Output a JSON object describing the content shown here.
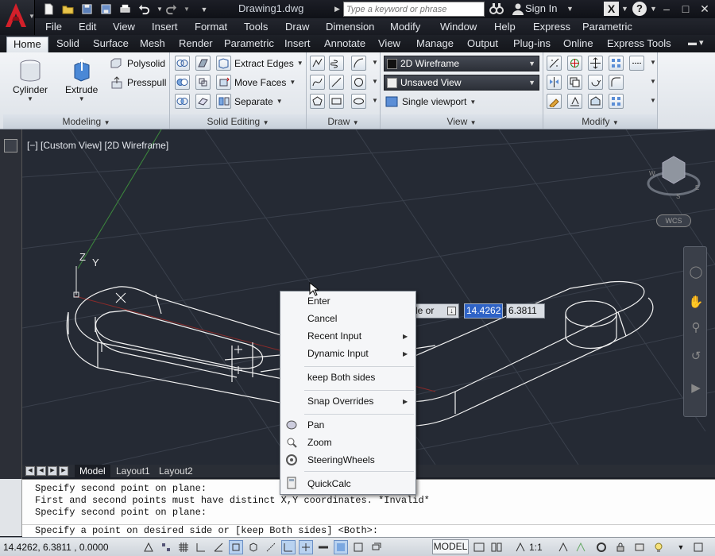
{
  "titlebar": {
    "document_title": "Drawing1.dwg",
    "search_placeholder": "Type a keyword or phrase",
    "signin_label": "Sign In"
  },
  "menu": [
    "File",
    "Edit",
    "View",
    "Insert",
    "Format",
    "Tools",
    "Draw",
    "Dimension",
    "Modify",
    "Window",
    "Help",
    "Express",
    "Parametric"
  ],
  "ribbon_tabs": [
    "Home",
    "Solid",
    "Surface",
    "Mesh",
    "Render",
    "Parametric",
    "Insert",
    "Annotate",
    "View",
    "Manage",
    "Output",
    "Plug-ins",
    "Online",
    "Express Tools"
  ],
  "active_tab": "Home",
  "panels": {
    "modeling": {
      "title": "Modeling",
      "cylinder": "Cylinder",
      "extrude": "Extrude",
      "polysolid": "Polysolid",
      "presspull": "Presspull"
    },
    "solid_editing": {
      "title": "Solid Editing",
      "extract_edges": "Extract Edges",
      "move_faces": "Move Faces",
      "separate": "Separate"
    },
    "draw": {
      "title": "Draw"
    },
    "view": {
      "title": "View",
      "visual_style": "2D Wireframe",
      "named_view": "Unsaved View",
      "viewport": "Single viewport"
    },
    "modify": {
      "title": "Modify"
    }
  },
  "viewport": {
    "label": "[−] [Custom View] [2D Wireframe]",
    "wcs": "WCS",
    "ucs_x": "Z",
    "ucs_y": "Y"
  },
  "dynamic_input": {
    "prompt": "de or",
    "x_value": "14.4262",
    "y_value": "6.3811"
  },
  "context_menu": {
    "items": [
      {
        "label": "Enter",
        "submenu": false
      },
      {
        "label": "Cancel",
        "submenu": false
      },
      {
        "label": "Recent Input",
        "submenu": true
      },
      {
        "label": "Dynamic Input",
        "submenu": true
      },
      {
        "label": "keep Both sides",
        "submenu": false
      },
      {
        "label": "Snap Overrides",
        "submenu": true
      },
      {
        "label": "Pan",
        "submenu": false,
        "icon": "pan-icon"
      },
      {
        "label": "Zoom",
        "submenu": false,
        "icon": "zoom-icon"
      },
      {
        "label": "SteeringWheels",
        "submenu": false,
        "icon": "steeringwheel-icon"
      },
      {
        "label": "QuickCalc",
        "submenu": false,
        "icon": "calculator-icon"
      }
    ]
  },
  "layout_tabs": [
    "Model",
    "Layout1",
    "Layout2"
  ],
  "command_history": [
    "Specify second point on plane:",
    "First and second points must have distinct X,Y coordinates. *Invalid*",
    "Specify second point on plane:"
  ],
  "command_prompt": "Specify a point on desired side or [keep Both sides] <Both>:",
  "statusbar": {
    "coordinates": "14.4262, 6.3811 , 0.0000",
    "model_label": "MODEL",
    "scale": "1:1"
  },
  "colors": {
    "canvas": "#252a34",
    "selection": "#2f63c6"
  }
}
